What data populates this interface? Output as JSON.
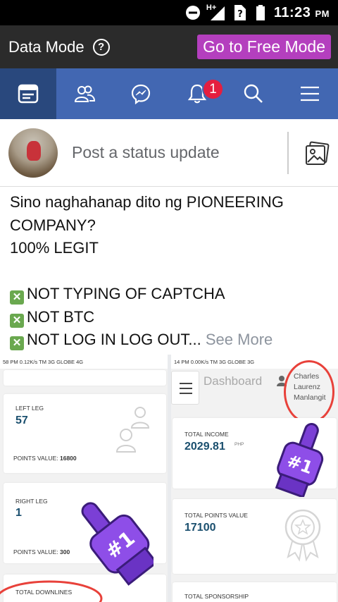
{
  "statusbar": {
    "network": "H+",
    "time": "11:23",
    "ampm": "PM"
  },
  "modebar": {
    "label": "Data Mode",
    "help_icon": "?",
    "free_button": "Go to Free Mode"
  },
  "navbar": {
    "items": [
      "news-feed-icon",
      "friends-icon",
      "messenger-icon",
      "notifications-icon",
      "search-icon",
      "menu-icon"
    ],
    "notification_count": "1"
  },
  "composer": {
    "placeholder": "Post a status update"
  },
  "post": {
    "lines": [
      "Sino naghahanap dito ng PIONEERING",
      "COMPANY?",
      "100% LEGIT",
      "",
      "NOT TYPING OF CAPTCHA",
      "NOT BTC",
      "NOT LOG IN LOG OUT..."
    ],
    "see_more": "See More",
    "check_symbol": "✕"
  },
  "photo": {
    "left": {
      "statusbar": "58 PM   0.12K/s   TM 3G   GLOBE 4G",
      "cards": [
        {
          "title": "LEFT LEG",
          "value": "57",
          "pv_label": "POINTS VALUE:",
          "pv_value": "16800"
        },
        {
          "title": "RIGHT LEG",
          "value": "1",
          "pv_label": "POINTS VALUE:",
          "pv_value": "300"
        },
        {
          "title": "TOTAL DOWNLINES"
        }
      ]
    },
    "right": {
      "statusbar": "14 PM   0.00K/s   TM 3G   GLOBE 3G",
      "dashboard_title": "Dashboard",
      "user_name": [
        "Charles",
        "Laurenz",
        "Manlangit"
      ],
      "cards": [
        {
          "title": "TOTAL INCOME",
          "value": "2029.81",
          "unit": "PHP"
        },
        {
          "title": "TOTAL POINTS VALUE",
          "value": "17100"
        },
        {
          "title": "TOTAL SPONSORSHIP"
        }
      ],
      "foam_finger_text": "#1"
    }
  }
}
